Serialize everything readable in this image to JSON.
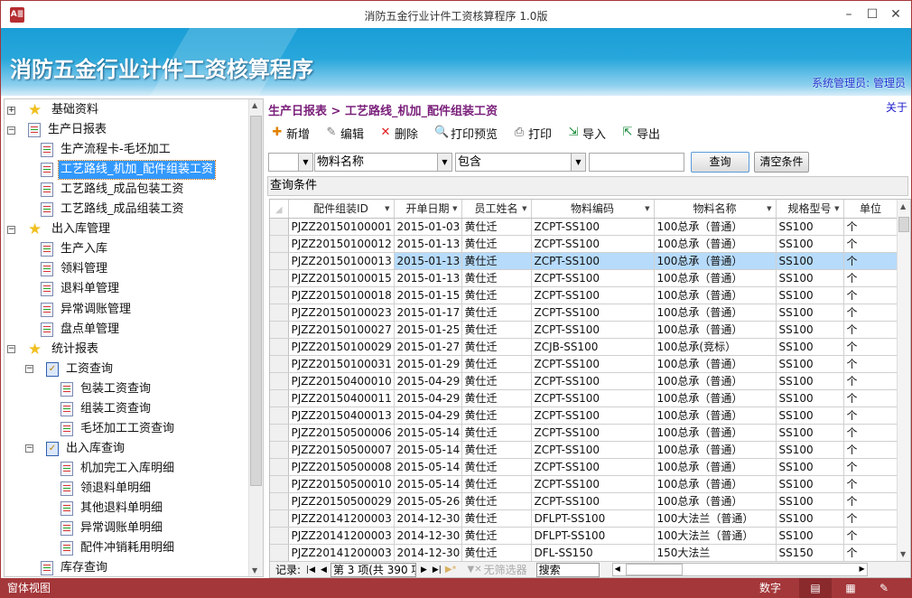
{
  "window": {
    "title": "消防五金行业计件工资核算程序 1.0版",
    "app_icon": "A≣",
    "minimize": "–",
    "maximize": "☐",
    "close": "✕"
  },
  "banner": {
    "title": "消防五金行业计件工资核算程序",
    "user": "系统管理员: 管理员"
  },
  "tree": [
    {
      "label": "基础资料",
      "icon": "star",
      "level": 0,
      "expander": "+"
    },
    {
      "label": "生产日报表",
      "icon": "page",
      "level": 0,
      "expander": "−"
    },
    {
      "label": "生产流程卡-毛坯加工",
      "icon": "doc",
      "level": 1
    },
    {
      "label": "工艺路线_机加_配件组装工资",
      "icon": "doc",
      "level": 1,
      "selected": true
    },
    {
      "label": "工艺路线_成品包装工资",
      "icon": "doc",
      "level": 1
    },
    {
      "label": "工艺路线_成品组装工资",
      "icon": "doc",
      "level": 1
    },
    {
      "label": "出入库管理",
      "icon": "star",
      "level": 0,
      "expander": "−"
    },
    {
      "label": "生产入库",
      "icon": "doc",
      "level": 1
    },
    {
      "label": "领料管理",
      "icon": "doc",
      "level": 1
    },
    {
      "label": "退料单管理",
      "icon": "doc",
      "level": 1
    },
    {
      "label": "异常调账管理",
      "icon": "doc",
      "level": 1
    },
    {
      "label": "盘点单管理",
      "icon": "doc",
      "level": 1
    },
    {
      "label": "统计报表",
      "icon": "star",
      "level": 0,
      "expander": "−"
    },
    {
      "label": "工资查询",
      "icon": "check",
      "level": 1,
      "expander": "−"
    },
    {
      "label": "包装工资查询",
      "icon": "doc",
      "level": 2
    },
    {
      "label": "组装工资查询",
      "icon": "doc",
      "level": 2
    },
    {
      "label": "毛坯加工工资查询",
      "icon": "doc",
      "level": 2
    },
    {
      "label": "出入库查询",
      "icon": "check",
      "level": 1,
      "expander": "−"
    },
    {
      "label": "机加完工入库明细",
      "icon": "doc",
      "level": 2
    },
    {
      "label": "领退料单明细",
      "icon": "doc",
      "level": 2
    },
    {
      "label": "其他退料单明细",
      "icon": "doc",
      "level": 2
    },
    {
      "label": "异常调账单明细",
      "icon": "doc",
      "level": 2
    },
    {
      "label": "配件冲销耗用明细",
      "icon": "doc",
      "level": 2
    },
    {
      "label": "库存查询",
      "icon": "doc",
      "level": 1
    }
  ],
  "breadcrumb": "生产日报表 > 工艺路线_机加_配件组装工资",
  "about": "关于",
  "toolbar": [
    {
      "label": "新增",
      "icon": "new-icon"
    },
    {
      "label": "编辑",
      "icon": "edit-icon"
    },
    {
      "label": "删除",
      "icon": "delete-icon"
    },
    {
      "label": "打印预览",
      "icon": "print-preview-icon"
    },
    {
      "label": "打印",
      "icon": "print-icon"
    },
    {
      "label": "导入",
      "icon": "import-icon"
    },
    {
      "label": "导出",
      "icon": "export-icon"
    }
  ],
  "filter": {
    "combo1": "",
    "field": "物料名称",
    "operator": "包含",
    "value": "",
    "query": "查询",
    "clear": "清空条件"
  },
  "query_conditions": "查询条件",
  "grid": {
    "columns": [
      "配件组装ID",
      "开单日期",
      "员工姓名",
      "物料编码",
      "物料名称",
      "规格型号",
      "单位"
    ],
    "selected_row": 2,
    "rows": [
      [
        "PJZZ20150100001",
        "2015-01-03",
        "黄仕迁",
        "ZCPT-SS100",
        "100总承（普通）",
        "SS100",
        "个"
      ],
      [
        "PJZZ20150100012",
        "2015-01-13",
        "黄仕迁",
        "ZCPT-SS100",
        "100总承（普通）",
        "SS100",
        "个"
      ],
      [
        "PJZZ20150100013",
        "2015-01-13",
        "黄仕迁",
        "ZCPT-SS100",
        "100总承（普通）",
        "SS100",
        "个"
      ],
      [
        "PJZZ20150100015",
        "2015-01-13",
        "黄仕迁",
        "ZCPT-SS100",
        "100总承（普通）",
        "SS100",
        "个"
      ],
      [
        "PJZZ20150100018",
        "2015-01-15",
        "黄仕迁",
        "ZCPT-SS100",
        "100总承（普通）",
        "SS100",
        "个"
      ],
      [
        "PJZZ20150100023",
        "2015-01-17",
        "黄仕迁",
        "ZCPT-SS100",
        "100总承（普通）",
        "SS100",
        "个"
      ],
      [
        "PJZZ20150100027",
        "2015-01-25",
        "黄仕迁",
        "ZCPT-SS100",
        "100总承（普通）",
        "SS100",
        "个"
      ],
      [
        "PJZZ20150100029",
        "2015-01-27",
        "黄仕迁",
        "ZCJB-SS100",
        "100总承(竞标）",
        "SS100",
        "个"
      ],
      [
        "PJZZ20150100031",
        "2015-01-29",
        "黄仕迁",
        "ZCPT-SS100",
        "100总承（普通）",
        "SS100",
        "个"
      ],
      [
        "PJZZ20150400010",
        "2015-04-29",
        "黄仕迁",
        "ZCPT-SS100",
        "100总承（普通）",
        "SS100",
        "个"
      ],
      [
        "PJZZ20150400011",
        "2015-04-29",
        "黄仕迁",
        "ZCPT-SS100",
        "100总承（普通）",
        "SS100",
        "个"
      ],
      [
        "PJZZ20150400013",
        "2015-04-29",
        "黄仕迁",
        "ZCPT-SS100",
        "100总承（普通）",
        "SS100",
        "个"
      ],
      [
        "PJZZ20150500006",
        "2015-05-14",
        "黄仕迁",
        "ZCPT-SS100",
        "100总承（普通）",
        "SS100",
        "个"
      ],
      [
        "PJZZ20150500007",
        "2015-05-14",
        "黄仕迁",
        "ZCPT-SS100",
        "100总承（普通）",
        "SS100",
        "个"
      ],
      [
        "PJZZ20150500008",
        "2015-05-14",
        "黄仕迁",
        "ZCPT-SS100",
        "100总承（普通）",
        "SS100",
        "个"
      ],
      [
        "PJZZ20150500010",
        "2015-05-14",
        "黄仕迁",
        "ZCPT-SS100",
        "100总承（普通）",
        "SS100",
        "个"
      ],
      [
        "PJZZ20150500029",
        "2015-05-26",
        "黄仕迁",
        "ZCPT-SS100",
        "100总承（普通）",
        "SS100",
        "个"
      ],
      [
        "PJZZ20141200003",
        "2014-12-30",
        "黄仕迁",
        "DFLPT-SS100",
        "100大法兰（普通）",
        "SS100",
        "个"
      ],
      [
        "PJZZ20141200003",
        "2014-12-30",
        "黄仕迁",
        "DFLPT-SS100",
        "100大法兰（普通）",
        "SS100",
        "个"
      ],
      [
        "PJZZ20141200003",
        "2014-12-30",
        "黄仕迁",
        "DFL-SS150",
        "150大法兰",
        "SS150",
        "个"
      ]
    ]
  },
  "navbar": {
    "record_label": "记录:",
    "position": "第 3 项(共 390 项",
    "no_filter": "无筛选器",
    "search": "搜索"
  },
  "statusbar": {
    "view": "窗体视图",
    "numlock": "数字"
  },
  "colors": {
    "status_bar": "#a4373a",
    "breadcrumb": "#7a1f7a",
    "selection": "#b7dbfb",
    "tree_selection": "#3399ff"
  }
}
